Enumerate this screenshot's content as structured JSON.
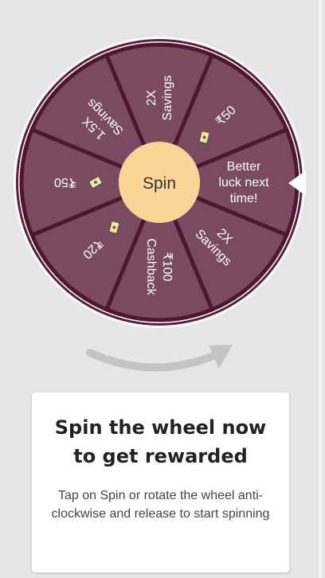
{
  "wheel": {
    "center_label": "Spin",
    "colors": {
      "segment": "#7a4a61",
      "divider": "#4e1630",
      "rim": "#5c1f3b",
      "center": "#fcd597",
      "text": "#ffffff",
      "pointer": "#ffffff"
    },
    "segments": [
      {
        "lines": [
          "2X",
          "Savings"
        ],
        "icon": ""
      },
      {
        "lines": [
          "₹50"
        ],
        "icon": "coupon-icon"
      },
      {
        "lines": [
          "Better",
          "luck next",
          "time!"
        ],
        "icon": ""
      },
      {
        "lines": [
          "2X",
          "Savings"
        ],
        "icon": ""
      },
      {
        "lines": [
          "₹100",
          "Cashback"
        ],
        "icon": ""
      },
      {
        "lines": [
          "₹20"
        ],
        "icon": "coupon-icon"
      },
      {
        "lines": [
          "₹50"
        ],
        "icon": "coupon-icon"
      },
      {
        "lines": [
          "1.5X",
          "Savings"
        ],
        "icon": ""
      }
    ]
  },
  "hint_arrow": {
    "icon": "curved-arrow-icon",
    "color": "#c4c4c4"
  },
  "card": {
    "title": "Spin the wheel now to get rewarded",
    "description": "Tap on Spin or rotate the wheel anti-clockwise and release to start spinning"
  }
}
